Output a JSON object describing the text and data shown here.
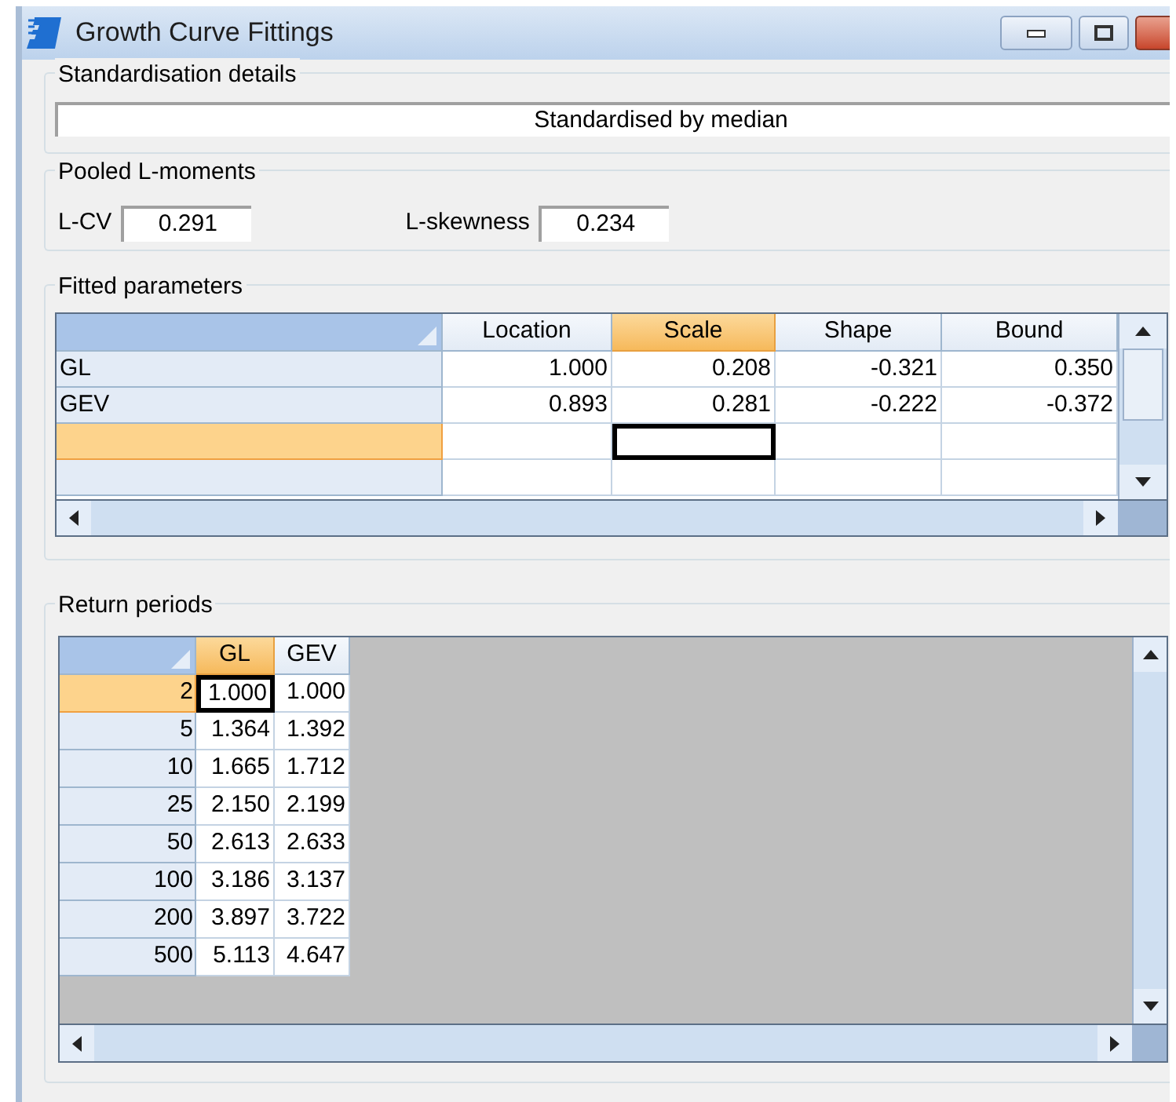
{
  "window": {
    "title": "Growth Curve Fittings"
  },
  "standardisation": {
    "label": "Standardisation details",
    "value": "Standardised by median"
  },
  "pooled_l_moments": {
    "label": "Pooled L-moments",
    "fields": [
      {
        "label": "L-CV",
        "value": "0.291"
      },
      {
        "label": "L-skewness",
        "value": "0.234"
      }
    ]
  },
  "fitted_parameters": {
    "label": "Fitted parameters",
    "columns": [
      {
        "label": "Location",
        "selected": false
      },
      {
        "label": "Scale",
        "selected": true
      },
      {
        "label": "Shape",
        "selected": false
      },
      {
        "label": "Bound",
        "selected": false
      }
    ],
    "rows": [
      {
        "label": "GL",
        "cells": [
          "1.000",
          "0.208",
          "-0.321",
          "0.350"
        ],
        "selected": false
      },
      {
        "label": "GEV",
        "cells": [
          "0.893",
          "0.281",
          "-0.222",
          "-0.372"
        ],
        "selected": false
      },
      {
        "selected": true
      },
      {
        "selected": false
      }
    ]
  },
  "return_periods": {
    "label": "Return periods",
    "columns": [
      {
        "label": "GL",
        "selected": true
      },
      {
        "label": "GEV",
        "selected": false
      }
    ],
    "rows": [
      {
        "label": "2",
        "cells": [
          "1.000",
          "1.000"
        ],
        "selected": true
      },
      {
        "label": "5",
        "cells": [
          "1.364",
          "1.392"
        ],
        "selected": false
      },
      {
        "label": "10",
        "cells": [
          "1.665",
          "1.712"
        ],
        "selected": false
      },
      {
        "label": "25",
        "cells": [
          "2.150",
          "2.199"
        ],
        "selected": false
      },
      {
        "label": "50",
        "cells": [
          "2.613",
          "2.633"
        ],
        "selected": false
      },
      {
        "label": "100",
        "cells": [
          "3.186",
          "3.137"
        ],
        "selected": false
      },
      {
        "label": "200",
        "cells": [
          "3.897",
          "3.722"
        ],
        "selected": false
      },
      {
        "label": "500",
        "cells": [
          "5.113",
          "4.647"
        ],
        "selected": false
      }
    ]
  }
}
